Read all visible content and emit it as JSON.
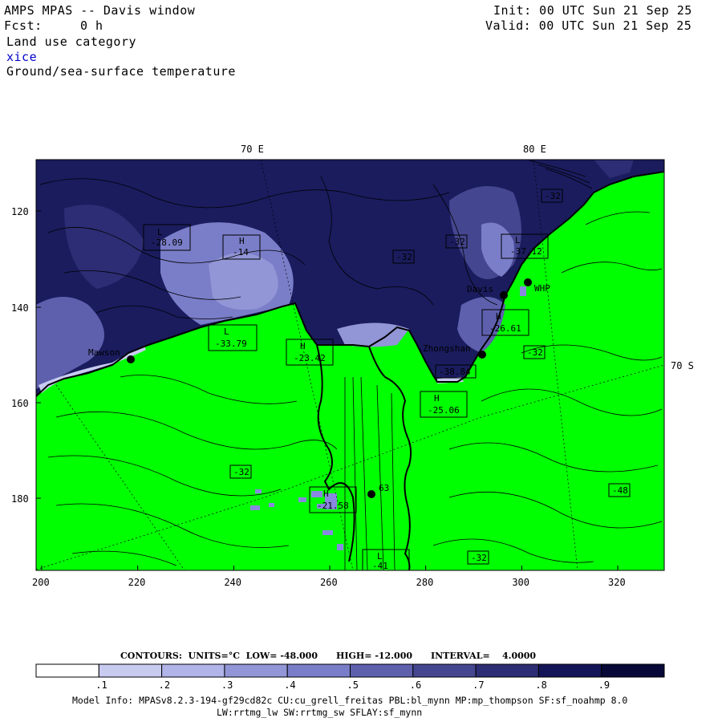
{
  "header": {
    "title": "AMPS MPAS -- Davis window",
    "forecast_label": "Fcst:",
    "forecast_value": "0 h",
    "init": "Init: 00 UTC Sun 21 Sep 25",
    "valid": "Valid: 00 UTC Sun 21 Sep 25",
    "field1": "Land use category",
    "field2": "xice",
    "field3": "Ground/sea-surface temperature"
  },
  "colors": {
    "land": "#00ff00",
    "ice_light": "#a8aee4",
    "ice_mid": "#6c6fb8",
    "ice_dark": "#1a1c5e",
    "xice_label": "#0000cc"
  },
  "map": {
    "lon_labels": [
      "70 E",
      "80 E"
    ],
    "lat_label": "70 S",
    "x_ticks": [
      "200",
      "220",
      "240",
      "260",
      "280",
      "300",
      "320"
    ],
    "y_ticks": [
      "120",
      "140",
      "160",
      "180"
    ],
    "stations": [
      {
        "name": "Mawson"
      },
      {
        "name": "Davis"
      },
      {
        "name": "WHP"
      },
      {
        "name": "Zhongshan"
      },
      {
        "name": "63"
      }
    ],
    "labels": [
      {
        "kind": "L",
        "value": "-28.09"
      },
      {
        "kind": "H",
        "value": "-14"
      },
      {
        "kind": "L",
        "value": "-37.12"
      },
      {
        "kind": "L",
        "value": "-33.79"
      },
      {
        "kind": "H",
        "value": "-23.42"
      },
      {
        "kind": "H",
        "value": "-26.61"
      },
      {
        "kind": "H",
        "value": "-25.06"
      },
      {
        "kind": "H",
        "value": "-21.58"
      },
      {
        "kind": "L",
        "value": "-41"
      },
      {
        "kind": "",
        "value": "-38.84"
      }
    ],
    "contour_labels": [
      "-32",
      "-32",
      "-32",
      "-32",
      "-32",
      "-32",
      "-32",
      "-48"
    ]
  },
  "legend": {
    "contours_info": "CONTOURS:  UNITS=°C  LOW= -48.000      HIGH= -12.000      INTERVAL=    4.0000",
    "bins": [
      ".1",
      ".2",
      ".3",
      ".4",
      ".5",
      ".6",
      ".7",
      ".8",
      ".9"
    ],
    "colors": [
      "#ffffff",
      "#c8cbf0",
      "#b0b4e8",
      "#9296d6",
      "#7a7ec8",
      "#5e60ae",
      "#44468f",
      "#2c2d74",
      "#141558",
      "#080838"
    ]
  },
  "footer": {
    "line1": "Model Info: MPASv8.2.3-194-gf29cd82c CU:cu_grell_freitas PBL:bl_mynn MP:mp_thompson SF:sf_noahmp 8.0",
    "line2": "LW:rrtmg_lw SW:rrtmg_sw SFLAY:sf_mynn"
  }
}
